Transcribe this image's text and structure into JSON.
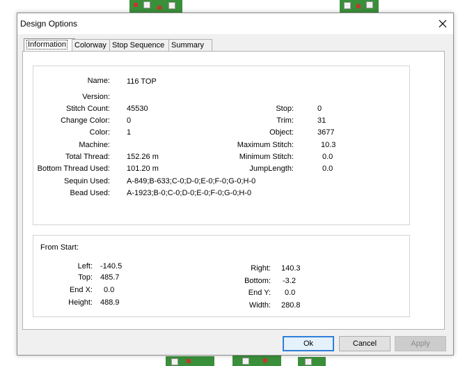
{
  "dialog": {
    "title": "Design Options"
  },
  "tabs": [
    {
      "label": "Information",
      "active": true
    },
    {
      "label": "Colorway",
      "active": false
    },
    {
      "label": "Stop Sequence",
      "active": false
    },
    {
      "label": "Summary",
      "active": false
    }
  ],
  "info": {
    "name": {
      "label": "Name:",
      "value": "116 TOP"
    },
    "version": {
      "label": "Version:",
      "value": ""
    },
    "stitch_count": {
      "label": "Stitch Count:",
      "value": "45530"
    },
    "change_color": {
      "label": "Change Color:",
      "value": "0"
    },
    "color": {
      "label": "Color:",
      "value": "1"
    },
    "machine": {
      "label": "Machine:",
      "value": ""
    },
    "total_thread": {
      "label": "Total Thread:",
      "value": "152.26 m"
    },
    "bottom_thread": {
      "label": "Bottom Thread Used:",
      "value": "101.20 m"
    },
    "sequin_used": {
      "label": "Sequin Used:",
      "value": "A-849;B-633;C-0;D-0;E-0;F-0;G-0;H-0"
    },
    "bead_used": {
      "label": "Bead Used:",
      "value": "A-1923;B-0;C-0;D-0;E-0;F-0;G-0;H-0"
    },
    "stop": {
      "label": "Stop:",
      "value": "0"
    },
    "trim": {
      "label": "Trim:",
      "value": "31"
    },
    "object": {
      "label": "Object:",
      "value": "3677"
    },
    "max_stitch": {
      "label": "Maximum Stitch:",
      "value": "10.3"
    },
    "min_stitch": {
      "label": "Minimum Stitch:",
      "value": "0.0"
    },
    "jump_length": {
      "label": "JumpLength:",
      "value": "0.0"
    }
  },
  "from_start": {
    "title": "From Start:",
    "left": {
      "label": "Left:",
      "value": "-140.5"
    },
    "top": {
      "label": "Top:",
      "value": "485.7"
    },
    "end_x": {
      "label": "End X:",
      "value": "0.0"
    },
    "height": {
      "label": "Height:",
      "value": "488.9"
    },
    "right": {
      "label": "Right:",
      "value": "140.3"
    },
    "bottom": {
      "label": "Bottom:",
      "value": "-3.2"
    },
    "end_y": {
      "label": "End Y:",
      "value": "0.0"
    },
    "width": {
      "label": "Width:",
      "value": "280.8"
    }
  },
  "buttons": {
    "ok": "Ok",
    "cancel": "Cancel",
    "apply": "Apply"
  },
  "icons": {
    "close": "close-icon"
  }
}
